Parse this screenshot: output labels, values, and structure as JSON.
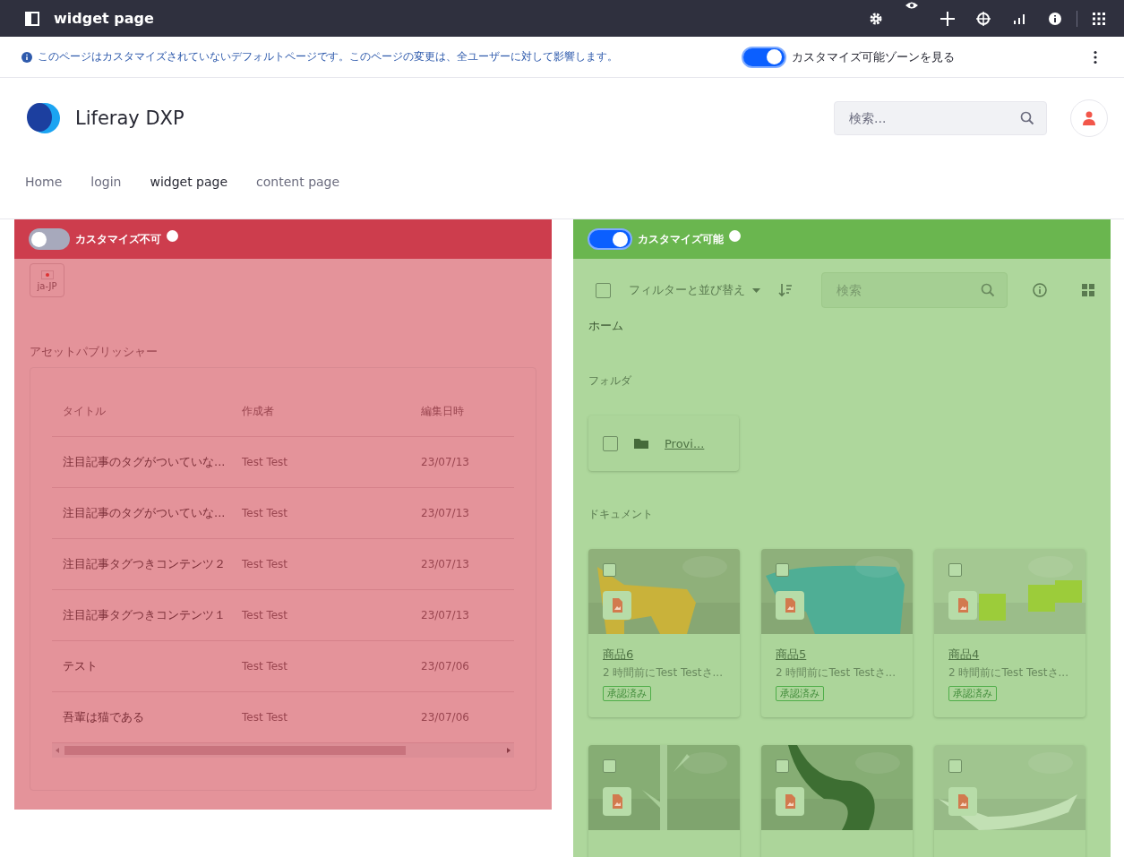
{
  "topbar": {
    "title": "widget page"
  },
  "info_bar": {
    "message": "このページはカスタマイズされていないデフォルトページです。このページの変更は、全ユーザーに対して影響します。",
    "toggle": {
      "label": "カスタマイズ可能ゾーンを見る",
      "on": true
    }
  },
  "header": {
    "site_name": "Liferay DXP",
    "search": {
      "placeholder": "検索..."
    }
  },
  "nav": [
    {
      "label": "Home",
      "selected": false
    },
    {
      "label": "login",
      "selected": false
    },
    {
      "label": "widget page",
      "selected": true
    },
    {
      "label": "content page",
      "selected": false
    }
  ],
  "zones": [
    {
      "kind": "table",
      "toggle": {
        "label": "カスタマイズ不可",
        "on": false
      },
      "language": "ja-JP",
      "title": "アセットパブリッシャー",
      "columns": [
        "タイトル",
        "作成者",
        "編集日時"
      ],
      "rows": [
        [
          "注目記事のタグがついていな...",
          "Test Test",
          "23/07/13"
        ],
        [
          "注目記事のタグがついていな...",
          "Test Test",
          "23/07/13"
        ],
        [
          "注目記事タグつきコンテンツ２",
          "Test Test",
          "23/07/13"
        ],
        [
          "注目記事タグつきコンテンツ１",
          "Test Test",
          "23/07/13"
        ],
        [
          "テスト",
          "Test Test",
          "23/07/06"
        ],
        [
          "吾輩は猫である",
          "Test Test",
          "23/07/06"
        ]
      ]
    },
    {
      "kind": "documents",
      "toggle": {
        "label": "カスタマイズ可能",
        "on": true
      },
      "toolbar": {
        "select_all": {
          "checked": false
        },
        "filter": "フィルターと並び替え",
        "search": {
          "placeholder": "検索"
        }
      },
      "breadcrumb": "ホーム",
      "folders_label": "フォルダ",
      "folders": [
        {
          "name": "Provi...",
          "checked": false
        }
      ],
      "documents_label": "ドキュメント",
      "cards": [
        {
          "title": "商品6",
          "subtitle": "2 時間前にTest Testさ...",
          "status": "承認済み",
          "checked": false
        },
        {
          "title": "商品5",
          "subtitle": "2 時間前にTest Testさ...",
          "status": "承認済み",
          "checked": false
        },
        {
          "title": "商品4",
          "subtitle": "2 時間前にTest Testさ...",
          "status": "承認済み",
          "checked": false
        },
        {
          "checked": false
        },
        {
          "checked": false
        },
        {
          "checked": false
        }
      ]
    }
  ]
}
